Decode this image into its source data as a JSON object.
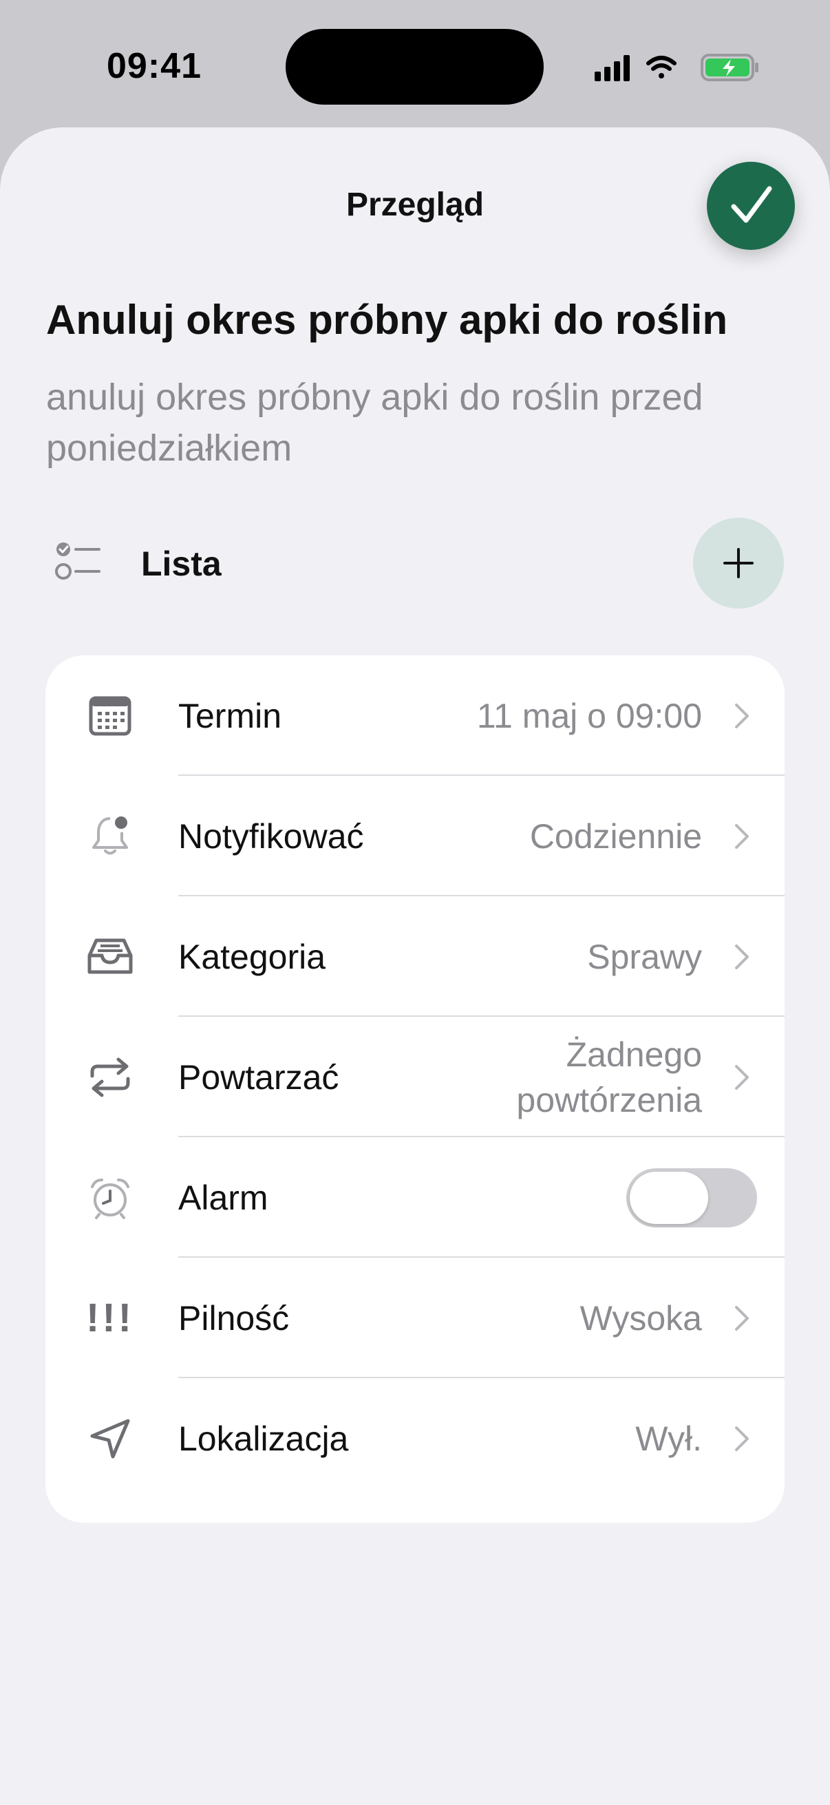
{
  "status_bar": {
    "time": "09:41"
  },
  "header": {
    "title": "Przegląd"
  },
  "task": {
    "title": "Anuluj okres próbny apki do roślin",
    "description": "anuluj okres próbny apki do roślin przed poniedziałkiem"
  },
  "list": {
    "label": "Lista"
  },
  "settings": {
    "due": {
      "label": "Termin",
      "value": "11 maj o 09:00"
    },
    "notify": {
      "label": "Notyfikować",
      "value": "Codziennie"
    },
    "category": {
      "label": "Kategoria",
      "value": "Sprawy"
    },
    "repeat": {
      "label": "Powtarzać",
      "value": "Żadnego powtórzenia"
    },
    "alarm": {
      "label": "Alarm",
      "enabled": false
    },
    "urgency": {
      "label": "Pilność",
      "value": "Wysoka",
      "icon_text": "!!!"
    },
    "location": {
      "label": "Lokalizacja",
      "value": "Wył."
    }
  },
  "colors": {
    "accent": "#1d6b4d",
    "add_button": "#d4e2e0",
    "battery": "#34c759"
  }
}
